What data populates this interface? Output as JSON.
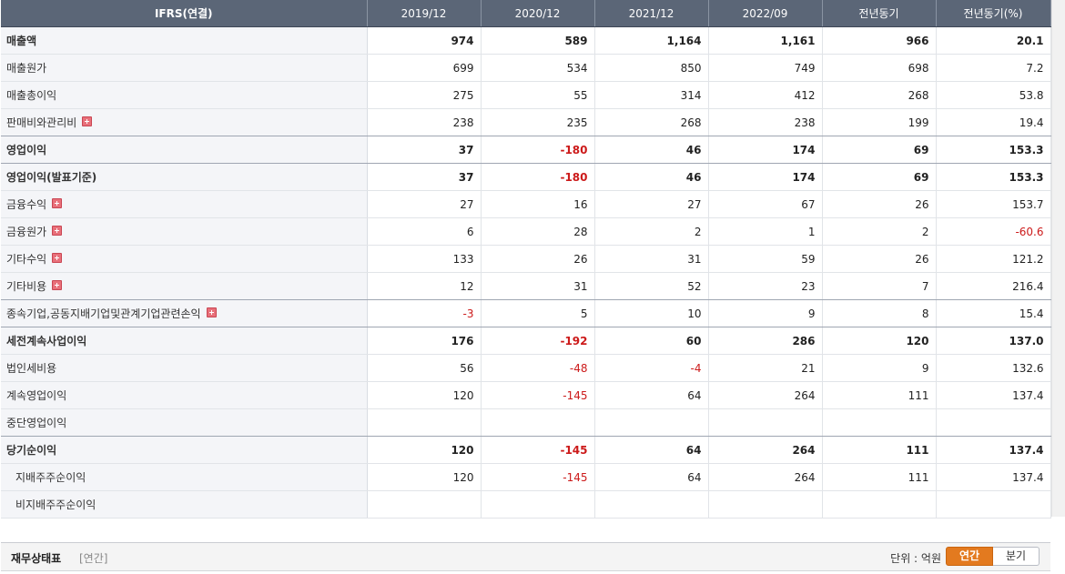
{
  "table": {
    "headers": [
      "IFRS(연결)",
      "2019/12",
      "2020/12",
      "2021/12",
      "2022/09",
      "전년동기",
      "전년동기(%)"
    ],
    "rows": [
      {
        "label": "매출액",
        "bold": true,
        "plus": false,
        "sub": false,
        "values": [
          "974",
          "589",
          "1,164",
          "1,161",
          "966",
          "20.1"
        ]
      },
      {
        "label": "매출원가",
        "bold": false,
        "plus": false,
        "sub": false,
        "values": [
          "699",
          "534",
          "850",
          "749",
          "698",
          "7.2"
        ]
      },
      {
        "label": "매출총이익",
        "bold": false,
        "plus": false,
        "sub": false,
        "values": [
          "275",
          "55",
          "314",
          "412",
          "268",
          "53.8"
        ]
      },
      {
        "label": "판매비와관리비",
        "bold": false,
        "plus": true,
        "sub": false,
        "values": [
          "238",
          "235",
          "268",
          "238",
          "199",
          "19.4"
        ]
      },
      {
        "label": "영업이익",
        "bold": true,
        "plus": false,
        "sub": false,
        "values": [
          "37",
          "-180",
          "46",
          "174",
          "69",
          "153.3"
        ]
      },
      {
        "label": "영업이익(발표기준)",
        "bold": true,
        "plus": false,
        "sub": false,
        "values": [
          "37",
          "-180",
          "46",
          "174",
          "69",
          "153.3"
        ]
      },
      {
        "label": "금융수익",
        "bold": false,
        "plus": true,
        "sub": false,
        "values": [
          "27",
          "16",
          "27",
          "67",
          "26",
          "153.7"
        ]
      },
      {
        "label": "금융원가",
        "bold": false,
        "plus": true,
        "sub": false,
        "values": [
          "6",
          "28",
          "2",
          "1",
          "2",
          "-60.6"
        ]
      },
      {
        "label": "기타수익",
        "bold": false,
        "plus": true,
        "sub": false,
        "values": [
          "133",
          "26",
          "31",
          "59",
          "26",
          "121.2"
        ]
      },
      {
        "label": "기타비용",
        "bold": false,
        "plus": true,
        "sub": false,
        "values": [
          "12",
          "31",
          "52",
          "23",
          "7",
          "216.4"
        ]
      },
      {
        "label": "종속기업,공동지배기업및관계기업관련손익",
        "bold": false,
        "plus": true,
        "sub": false,
        "values": [
          "-3",
          "5",
          "10",
          "9",
          "8",
          "15.4"
        ]
      },
      {
        "label": "세전계속사업이익",
        "bold": true,
        "plus": false,
        "sub": false,
        "values": [
          "176",
          "-192",
          "60",
          "286",
          "120",
          "137.0"
        ]
      },
      {
        "label": "법인세비용",
        "bold": false,
        "plus": false,
        "sub": false,
        "values": [
          "56",
          "-48",
          "-4",
          "21",
          "9",
          "132.6"
        ]
      },
      {
        "label": "계속영업이익",
        "bold": false,
        "plus": false,
        "sub": false,
        "values": [
          "120",
          "-145",
          "64",
          "264",
          "111",
          "137.4"
        ]
      },
      {
        "label": "중단영업이익",
        "bold": false,
        "plus": false,
        "sub": false,
        "values": [
          "",
          "",
          "",
          "",
          "",
          ""
        ]
      },
      {
        "label": "당기순이익",
        "bold": true,
        "plus": false,
        "sub": false,
        "values": [
          "120",
          "-145",
          "64",
          "264",
          "111",
          "137.4"
        ]
      },
      {
        "label": "지배주주순이익",
        "bold": false,
        "plus": false,
        "sub": true,
        "values": [
          "120",
          "-145",
          "64",
          "264",
          "111",
          "137.4"
        ]
      },
      {
        "label": "비지배주주순이익",
        "bold": false,
        "plus": false,
        "sub": true,
        "values": [
          "",
          "",
          "",
          "",
          "",
          ""
        ]
      }
    ]
  },
  "footer": {
    "title": "재무상태표",
    "period": "[연간]",
    "unit": "단위 : 억원",
    "tab_annual": "연간",
    "tab_quarter": "분기"
  },
  "colors": {
    "header_bg": "#5b6677",
    "negative": "#cc1a1a",
    "active_tab": "#e37a1f"
  }
}
